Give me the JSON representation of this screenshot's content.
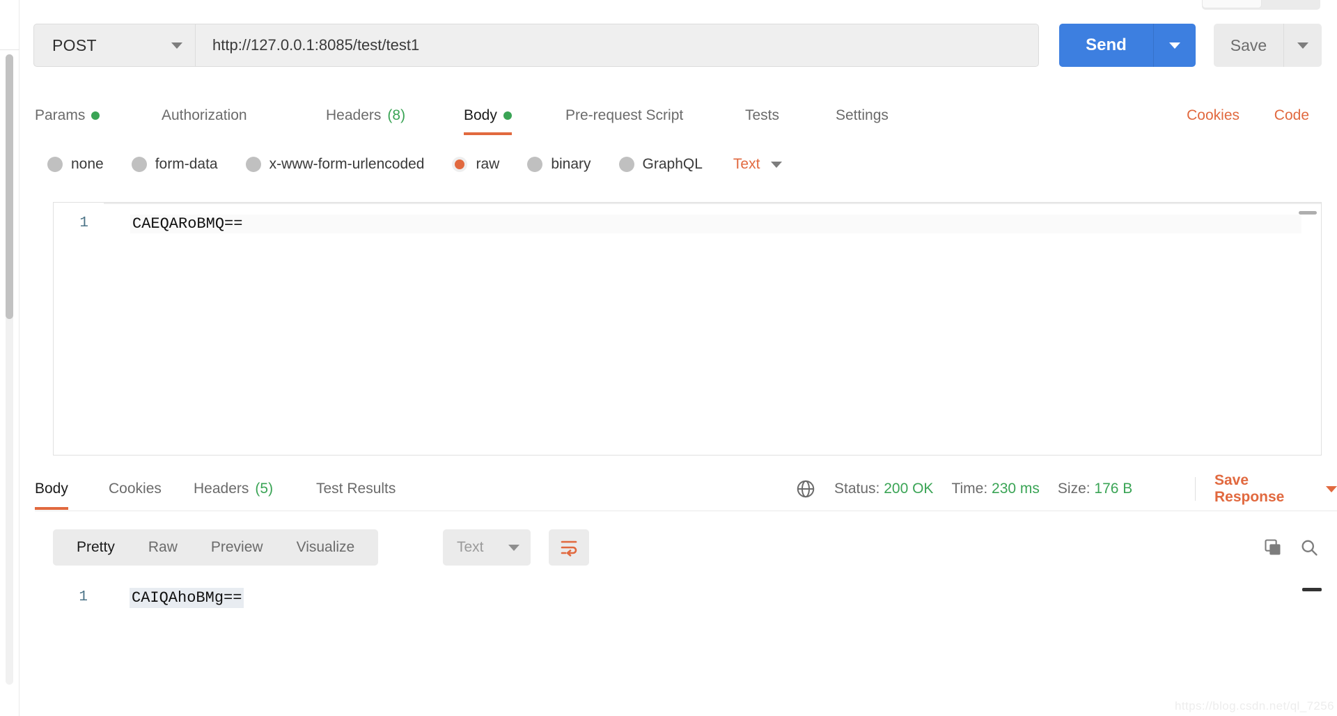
{
  "request": {
    "method": "POST",
    "url": "http://127.0.0.1:8085/test/test1",
    "send_label": "Send",
    "save_label": "Save",
    "tabs": [
      {
        "label": "Params",
        "dot": true,
        "count": null,
        "active": false
      },
      {
        "label": "Authorization",
        "dot": false,
        "count": null,
        "active": false
      },
      {
        "label": "Headers",
        "dot": false,
        "count": "(8)",
        "active": false
      },
      {
        "label": "Body",
        "dot": true,
        "count": null,
        "active": true
      },
      {
        "label": "Pre-request Script",
        "dot": false,
        "count": null,
        "active": false
      },
      {
        "label": "Tests",
        "dot": false,
        "count": null,
        "active": false
      },
      {
        "label": "Settings",
        "dot": false,
        "count": null,
        "active": false
      }
    ],
    "cookies_link": "Cookies",
    "code_link": "Code",
    "body_types": [
      {
        "label": "none",
        "selected": false
      },
      {
        "label": "form-data",
        "selected": false
      },
      {
        "label": "x-www-form-urlencoded",
        "selected": false
      },
      {
        "label": "raw",
        "selected": true
      },
      {
        "label": "binary",
        "selected": false
      },
      {
        "label": "GraphQL",
        "selected": false
      }
    ],
    "body_format": "Text",
    "body_line_number": "1",
    "body_text": "CAEQARoBMQ=="
  },
  "response": {
    "tabs": [
      {
        "label": "Body",
        "count": null,
        "active": true
      },
      {
        "label": "Cookies",
        "count": null,
        "active": false
      },
      {
        "label": "Headers",
        "count": "(5)",
        "active": false
      },
      {
        "label": "Test Results",
        "count": null,
        "active": false
      }
    ],
    "status_label": "Status:",
    "status_value": "200 OK",
    "time_label": "Time:",
    "time_value": "230 ms",
    "size_label": "Size:",
    "size_value": "176 B",
    "save_response_label": "Save Response",
    "view_modes": [
      {
        "label": "Pretty",
        "active": true
      },
      {
        "label": "Raw",
        "active": false
      },
      {
        "label": "Preview",
        "active": false
      },
      {
        "label": "Visualize",
        "active": false
      }
    ],
    "format": "Text",
    "body_line_number": "1",
    "body_text": "CAIQAhoBMg=="
  },
  "watermark": "https://blog.csdn.net/ql_7256",
  "colors": {
    "accent_orange": "#e1693f",
    "send_blue": "#3d7fe0",
    "success_green": "#3aa455"
  }
}
